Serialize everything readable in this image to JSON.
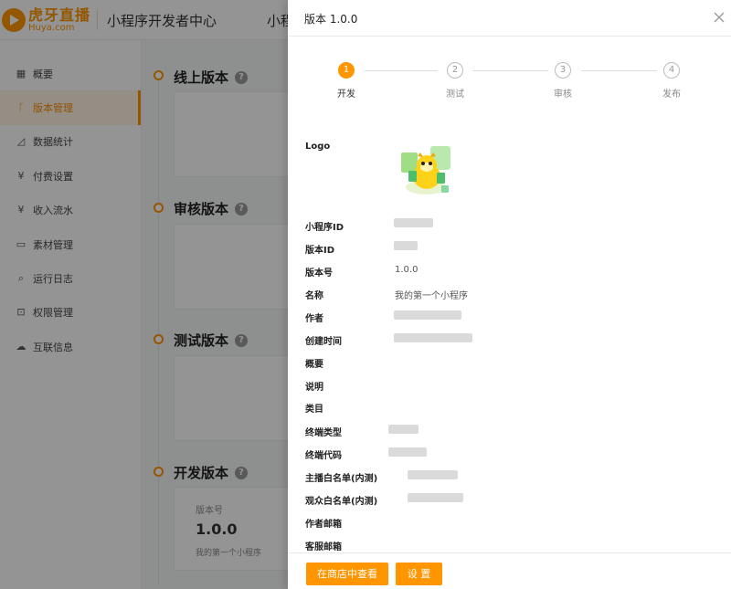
{
  "header": {
    "brand_cn": "虎牙直播",
    "brand_en": "Huya.com",
    "title": "小程序开发者中心",
    "title_partial": "小程"
  },
  "sidebar": {
    "items": [
      {
        "label": "概要",
        "icon": "grid-icon"
      },
      {
        "label": "版本管理",
        "icon": "branch-icon",
        "active": true
      },
      {
        "label": "数据统计",
        "icon": "chart-icon"
      },
      {
        "label": "付费设置",
        "icon": "payment-icon"
      },
      {
        "label": "收入流水",
        "icon": "income-icon"
      },
      {
        "label": "素材管理",
        "icon": "folder-icon"
      },
      {
        "label": "运行日志",
        "icon": "search-log-icon"
      },
      {
        "label": "权限管理",
        "icon": "lock-icon"
      },
      {
        "label": "互联信息",
        "icon": "cloud-icon"
      }
    ]
  },
  "main": {
    "sections": [
      {
        "title": "线上版本"
      },
      {
        "title": "审核版本"
      },
      {
        "title": "测试版本"
      },
      {
        "title": "开发版本"
      }
    ],
    "dev_card": {
      "version_label": "版本号",
      "version": "1.0.0",
      "name": "我的第一个小程序"
    }
  },
  "drawer": {
    "title": "版本 1.0.0",
    "steps": [
      {
        "num": "1",
        "label": "开发",
        "active": true
      },
      {
        "num": "2",
        "label": "测试"
      },
      {
        "num": "3",
        "label": "审核"
      },
      {
        "num": "4",
        "label": "发布"
      }
    ],
    "fields": {
      "logo": "Logo",
      "app_id": "小程序ID",
      "version_id": "版本ID",
      "version_no": "版本号",
      "version_no_value": "1.0.0",
      "name": "名称",
      "name_value": "我的第一个小程序",
      "author": "作者",
      "created": "创建时间",
      "summary": "概要",
      "description": "说明",
      "category": "类目",
      "terminal_type": "终端类型",
      "terminal_code": "终端代码",
      "anchor_whitelist": "主播白名单(内测)",
      "audience_whitelist": "观众白名单(内测)",
      "author_email": "作者邮箱",
      "service_email": "客服邮箱"
    },
    "buttons": {
      "view_in_store": "在商店中查看",
      "settings": "设 置"
    }
  },
  "colors": {
    "accent": "#ff9600",
    "overlay": "rgba(0,0,0,0.42)"
  }
}
